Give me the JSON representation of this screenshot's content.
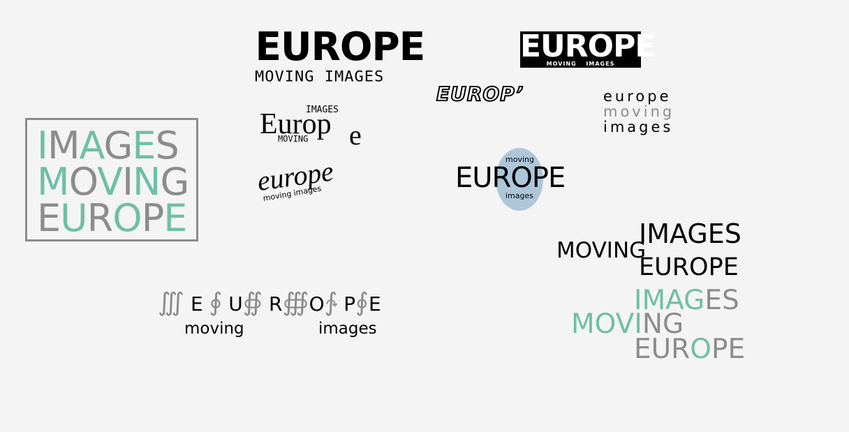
{
  "logos": {
    "grunge": {
      "title": "EUROPE",
      "subtitle": "MOVING IMAGES"
    },
    "block": {
      "title": "EUROPE",
      "subtitle": "MOVING IMAGES"
    },
    "outline": {
      "title": "EUROP’"
    },
    "serif": {
      "top": "IMAGES",
      "word": "Europ",
      "tail": "e",
      "bottom": "MOVING"
    },
    "hand": {
      "word": "europe",
      "subtitle": "moving images"
    },
    "stack": {
      "line1": "europe",
      "line2": "moving",
      "line3": "images"
    },
    "box": {
      "line1": "IMAGES",
      "line2": "MOVING",
      "line3": "EUROPE"
    },
    "oval": {
      "word": "EUROPE",
      "top": "moving",
      "bottom": "images"
    },
    "dotted": {
      "word": "EUROPE",
      "left": "moving",
      "right": "images"
    },
    "stag_black": {
      "images": "IMAGES",
      "moving": "MOVING",
      "europe": "EUROPE"
    },
    "stag_color": {
      "images": "IMAGES",
      "moving": "MOVING",
      "europe": "EUROPE"
    }
  },
  "colors": {
    "teal": "#6fbfa6",
    "gray": "#8c8c8c",
    "oval": "#adc7d9",
    "background": "#f4f4f4"
  }
}
